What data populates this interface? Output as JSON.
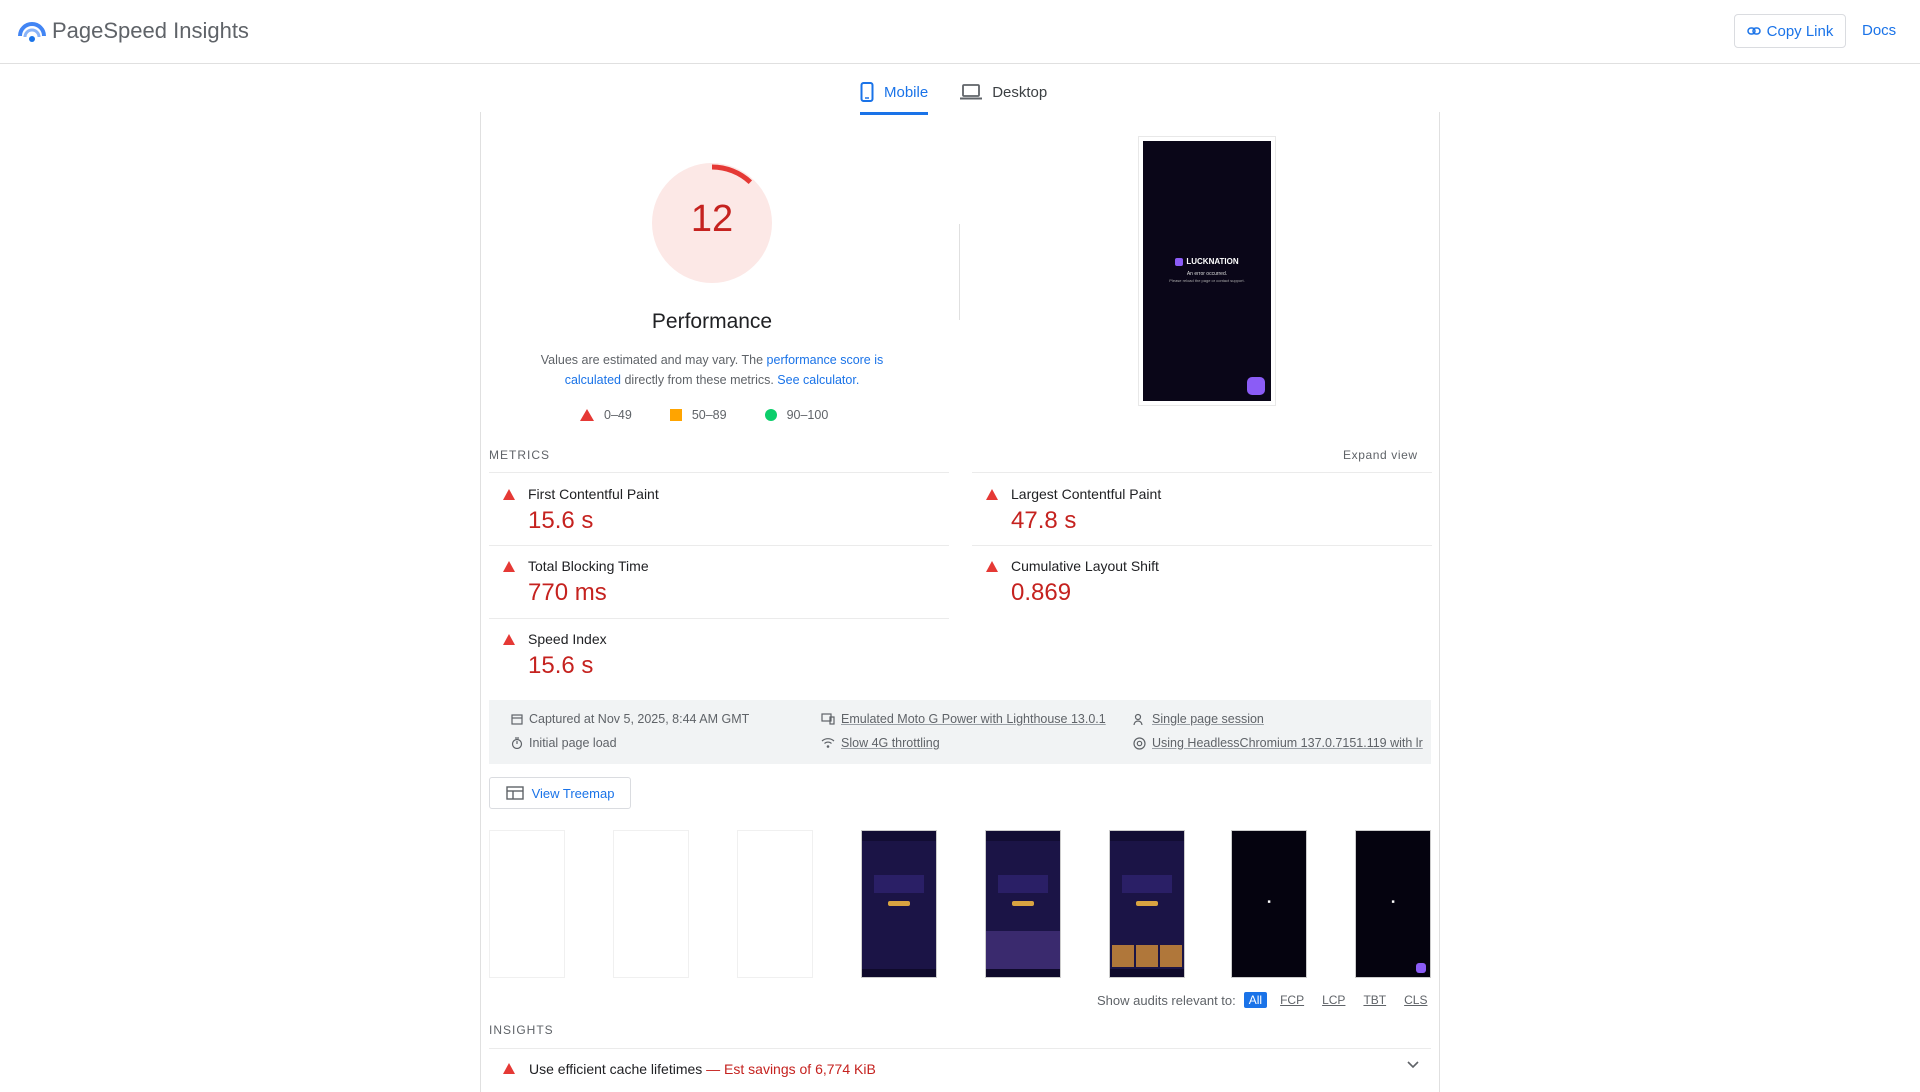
{
  "header": {
    "app_title": "PageSpeed Insights",
    "copy_link_label": "Copy Link",
    "docs_label": "Docs"
  },
  "tabs": [
    {
      "label": "Mobile",
      "active": true
    },
    {
      "label": "Desktop",
      "active": false
    }
  ],
  "summary": {
    "score": "12",
    "score_fraction": 0.12,
    "title": "Performance",
    "desc_prefix": "Values are estimated and may vary. The ",
    "desc_link1": "performance score is calculated",
    "desc_mid": " directly from these metrics. ",
    "desc_link2": "See calculator.",
    "legend": [
      "0–49",
      "50–89",
      "90–100"
    ]
  },
  "screenshot": {
    "brand": "LUCKNATION",
    "error_line1": "An error occurred.",
    "error_line2": "Please reload the page or contact support."
  },
  "metrics": {
    "section_label": "METRICS",
    "expand_label": "Expand view",
    "items": [
      {
        "name": "First Contentful Paint",
        "value": "15.6 s"
      },
      {
        "name": "Largest Contentful Paint",
        "value": "47.8 s"
      },
      {
        "name": "Total Blocking Time",
        "value": "770 ms"
      },
      {
        "name": "Cumulative Layout Shift",
        "value": "0.869"
      },
      {
        "name": "Speed Index",
        "value": "15.6 s"
      }
    ]
  },
  "environment": {
    "captured": "Captured at Nov 5, 2025, 8:44 AM GMT",
    "load": "Initial page load",
    "device": "Emulated Moto G Power with Lighthouse 13.0.1",
    "throttling": "Slow 4G throttling",
    "session": "Single page session",
    "browser": "Using HeadlessChromium 137.0.7151.119 with lr"
  },
  "treemap_label": "View Treemap",
  "audits_filter": {
    "label": "Show audits relevant to:",
    "chips": [
      "All",
      "FCP",
      "LCP",
      "TBT",
      "CLS"
    ]
  },
  "insights": {
    "section_label": "INSIGHTS",
    "first_title": "Use efficient cache lifetimes",
    "first_savings": " — Est savings of 6,774 KiB"
  },
  "colors": {
    "accent": "#1a73e8",
    "fail": "#c5221f",
    "fail_icon": "#e53935",
    "average": "#ffa400",
    "pass": "#0cce6b",
    "gauge_bg": "#fce8e6"
  }
}
